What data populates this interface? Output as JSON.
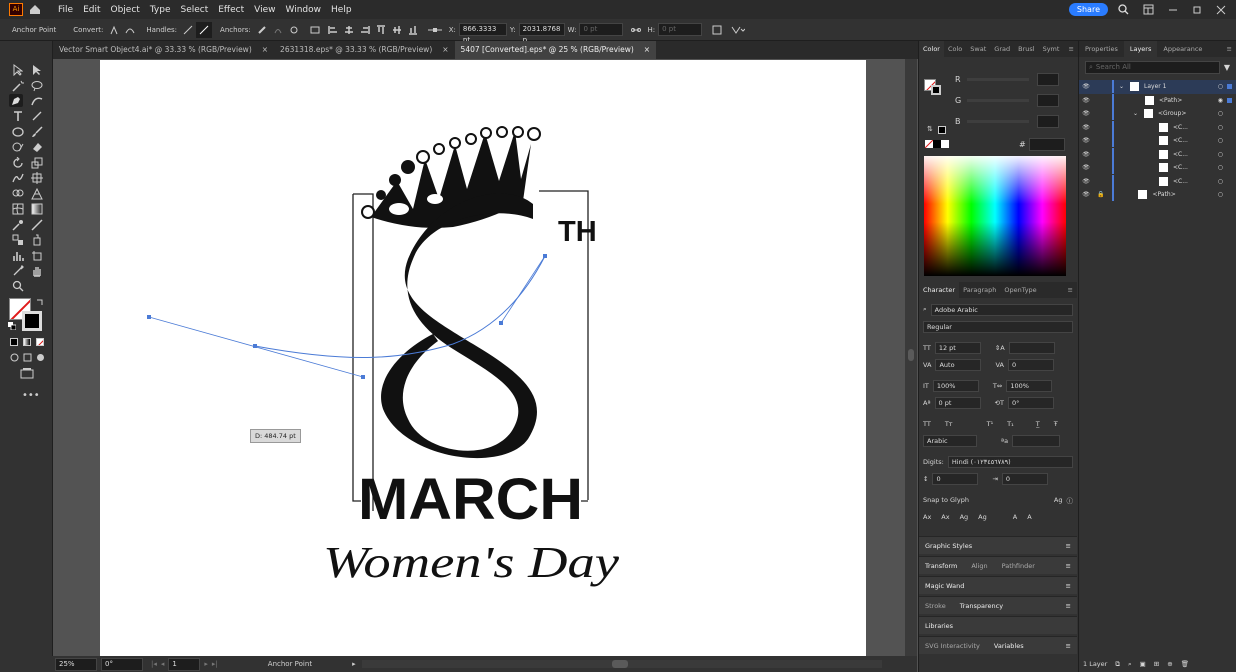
{
  "menu": {
    "items": [
      "File",
      "Edit",
      "Object",
      "Type",
      "Select",
      "Effect",
      "View",
      "Window",
      "Help"
    ],
    "share": "Share"
  },
  "control": {
    "mode": "Anchor Point",
    "convert": "Convert:",
    "handles": "Handles:",
    "anchors": "Anchors:",
    "x_label": "X:",
    "x_value": "866.3333 pt",
    "y_label": "Y:",
    "y_value": "2031.8768 p",
    "w_label": "W:",
    "w_value": "0 pt",
    "h_label": "H:",
    "h_value": "0 pt"
  },
  "doc_tabs": [
    {
      "label": "Vector Smart Object4.ai* @ 33.33 % (RGB/Preview)"
    },
    {
      "label": "2631318.eps* @ 33.33 % (RGB/Preview)"
    },
    {
      "label": "5407 [Converted].eps* @ 25 % (RGB/Preview)"
    }
  ],
  "tooltip": "D: 484.74 pt",
  "art": {
    "numeral": "8",
    "suffix": "TH",
    "title": "MARCH",
    "subtitle": "Women's Day"
  },
  "status": {
    "zoom": "25%",
    "rotation": "0°",
    "artboard": "1",
    "tool": "Anchor Point"
  },
  "color_panel": {
    "tabs": [
      "Color",
      "Colo",
      "Swat",
      "Grad",
      "Brusl",
      "Symt"
    ],
    "channels": [
      "R",
      "G",
      "B"
    ],
    "hex_label": "#"
  },
  "character": {
    "tabs": [
      "Character",
      "Paragraph",
      "OpenType"
    ],
    "font": "Adobe Arabic",
    "style": "Regular",
    "size": "12 pt",
    "leading": "Auto",
    "kerning": "Auto",
    "tracking": "0",
    "vscale": "100%",
    "hscale": "100%",
    "baseline": "0 pt",
    "rotation": "0°",
    "language": "Arabic",
    "digits_label": "Digits:",
    "digits": "Hindi (٠١٢٣٤٥٦٧٨٩)",
    "spacing1": "0",
    "spacing2": "0",
    "snap": "Snap to Glyph"
  },
  "sections": [
    "Graphic Styles",
    "Transform",
    "Align",
    "Pathfinder",
    "Magic Wand",
    "Stroke",
    "Transparency",
    "Libraries",
    "SVG Interactivity",
    "Variables"
  ],
  "right_tabs": [
    "Properties",
    "Layers",
    "Appearance"
  ],
  "layers": {
    "search_placeholder": "Search All",
    "rows": [
      "Layer 1",
      "<Path>",
      "<Group>",
      "<C...",
      "<C...",
      "<C...",
      "<C...",
      "<C...",
      "<Path>"
    ],
    "footer": "1 Layer"
  },
  "colors": {
    "accent": "#2a7cff",
    "selection": "#4b7bd6"
  }
}
